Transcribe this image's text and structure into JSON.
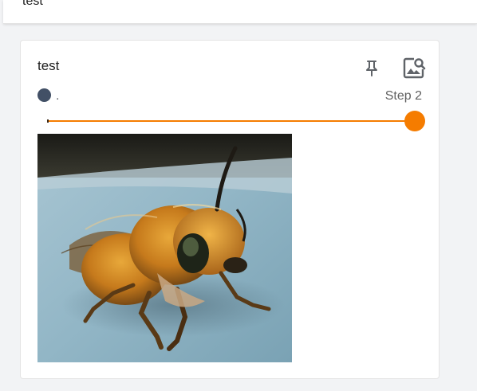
{
  "header": {
    "title": "test"
  },
  "card": {
    "title": "test",
    "pin_icon": "pin-icon",
    "image_search_icon": "image-search-icon",
    "run": {
      "name": ".",
      "color": "#425066"
    },
    "step_label": "Step 2",
    "slider": {
      "accent_color": "#f57c00",
      "value_fraction": 1.0
    },
    "image": {
      "subject": "bee"
    }
  }
}
